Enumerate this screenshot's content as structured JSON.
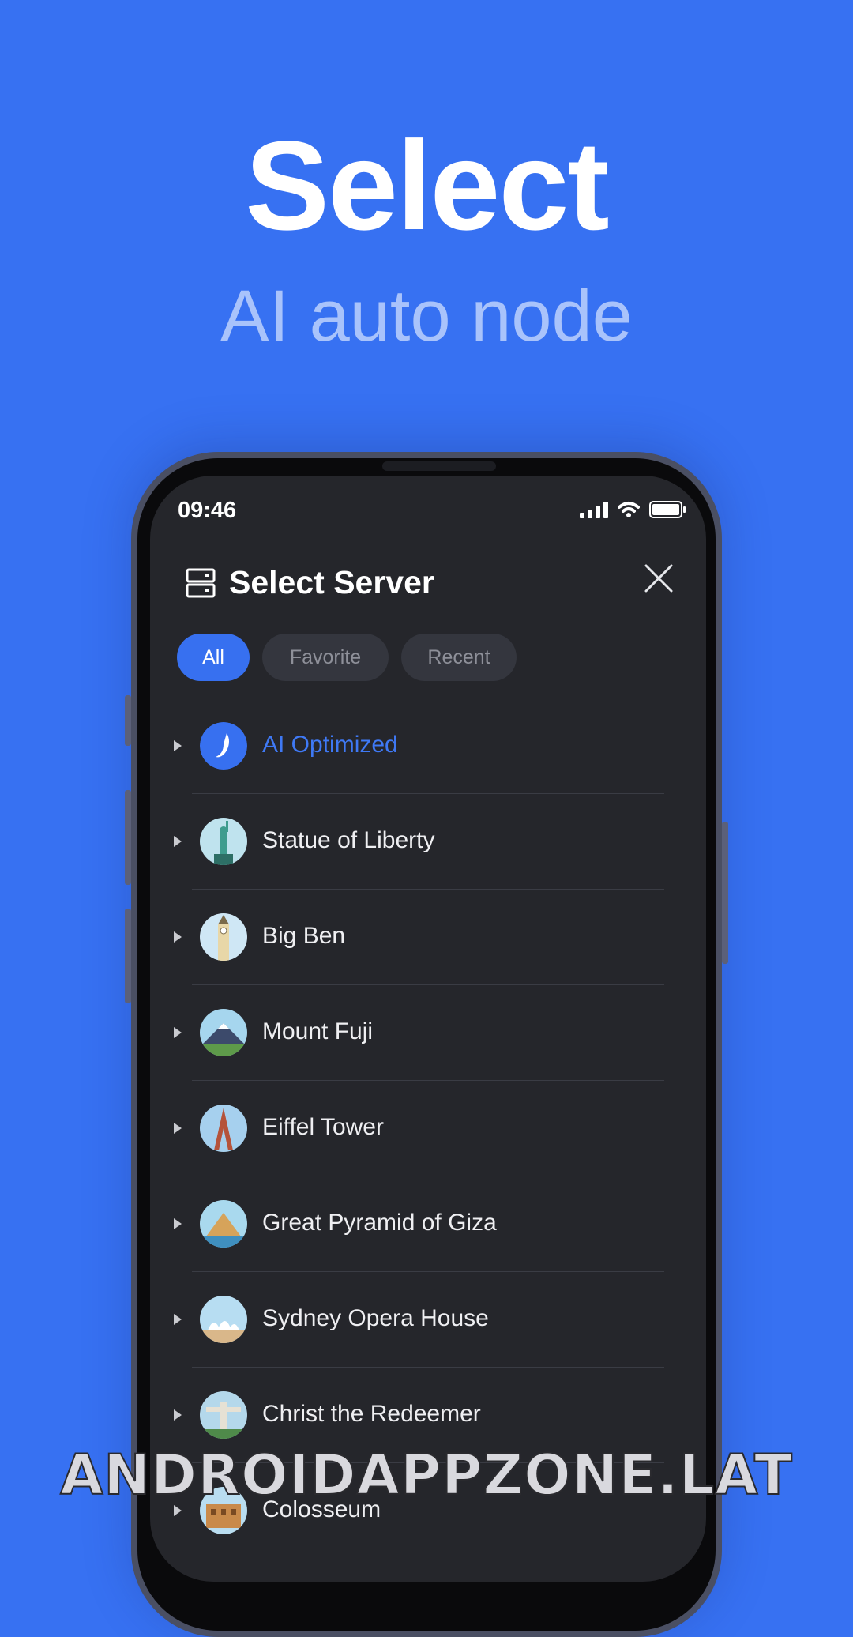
{
  "promo": {
    "headline": "Select",
    "subheadline": "AI auto node"
  },
  "status_bar": {
    "time": "09:46",
    "icons": [
      "signal-icon",
      "wifi-icon",
      "battery-icon"
    ]
  },
  "header": {
    "icon": "server-icon",
    "title": "Select Server",
    "close_icon": "close-icon"
  },
  "tabs": [
    {
      "label": "All",
      "active": true
    },
    {
      "label": "Favorite",
      "active": false
    },
    {
      "label": "Recent",
      "active": false
    }
  ],
  "servers": [
    {
      "name": "AI Optimized",
      "icon": "ai-logo-icon",
      "highlight": true
    },
    {
      "name": "Statue of Liberty",
      "icon": "statue-of-liberty-icon"
    },
    {
      "name": "Big Ben",
      "icon": "big-ben-icon"
    },
    {
      "name": "Mount Fuji",
      "icon": "mount-fuji-icon"
    },
    {
      "name": "Eiffel Tower",
      "icon": "eiffel-tower-icon"
    },
    {
      "name": "Great Pyramid of Giza",
      "icon": "pyramid-icon"
    },
    {
      "name": "Sydney Opera House",
      "icon": "opera-house-icon"
    },
    {
      "name": "Christ the Redeemer",
      "icon": "christ-redeemer-icon"
    },
    {
      "name": "Colosseum",
      "icon": "colosseum-icon"
    }
  ],
  "watermark": "ANDROIDAPPZONE.LAT",
  "colors": {
    "background": "#3771F2",
    "screen": "#25262B",
    "accent": "#3770F0"
  }
}
